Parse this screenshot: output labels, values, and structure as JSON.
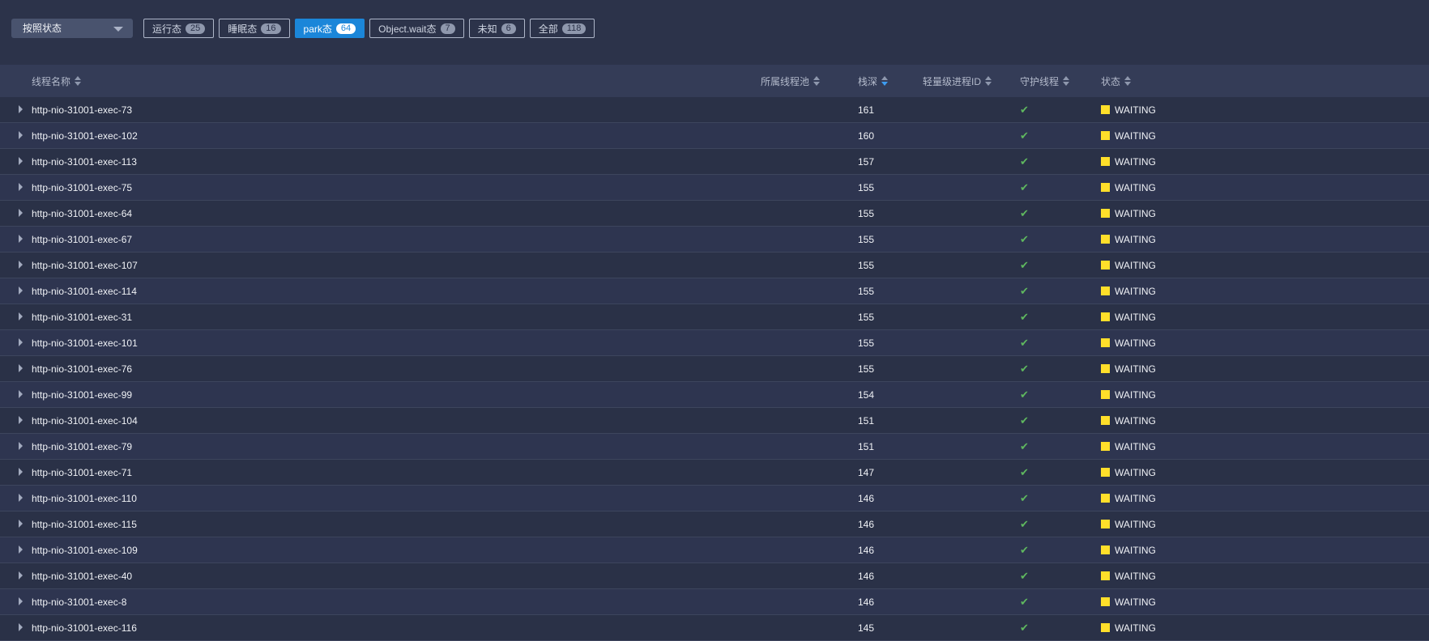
{
  "toolbar": {
    "group_select": {
      "value": "按照状态"
    },
    "filters": [
      {
        "label": "运行态",
        "count": "25",
        "active": false
      },
      {
        "label": "睡眠态",
        "count": "16",
        "active": false
      },
      {
        "label": "park态",
        "count": "64",
        "active": true
      },
      {
        "label": "Object.wait态",
        "count": "7",
        "active": false
      },
      {
        "label": "未知",
        "count": "6",
        "active": false
      },
      {
        "label": "全部",
        "count": "118",
        "active": false
      }
    ]
  },
  "table": {
    "columns": {
      "name": "线程名称",
      "pool": "所属线程池",
      "depth": "栈深",
      "lwp": "轻量级进程ID",
      "daemon": "守护线程",
      "state": "状态"
    },
    "sorted_by": "depth",
    "rows": [
      {
        "name": "http-nio-31001-exec-73",
        "depth": "161",
        "daemon": true,
        "state": "WAITING"
      },
      {
        "name": "http-nio-31001-exec-102",
        "depth": "160",
        "daemon": true,
        "state": "WAITING"
      },
      {
        "name": "http-nio-31001-exec-113",
        "depth": "157",
        "daemon": true,
        "state": "WAITING"
      },
      {
        "name": "http-nio-31001-exec-75",
        "depth": "155",
        "daemon": true,
        "state": "WAITING"
      },
      {
        "name": "http-nio-31001-exec-64",
        "depth": "155",
        "daemon": true,
        "state": "WAITING"
      },
      {
        "name": "http-nio-31001-exec-67",
        "depth": "155",
        "daemon": true,
        "state": "WAITING"
      },
      {
        "name": "http-nio-31001-exec-107",
        "depth": "155",
        "daemon": true,
        "state": "WAITING"
      },
      {
        "name": "http-nio-31001-exec-114",
        "depth": "155",
        "daemon": true,
        "state": "WAITING"
      },
      {
        "name": "http-nio-31001-exec-31",
        "depth": "155",
        "daemon": true,
        "state": "WAITING"
      },
      {
        "name": "http-nio-31001-exec-101",
        "depth": "155",
        "daemon": true,
        "state": "WAITING"
      },
      {
        "name": "http-nio-31001-exec-76",
        "depth": "155",
        "daemon": true,
        "state": "WAITING"
      },
      {
        "name": "http-nio-31001-exec-99",
        "depth": "154",
        "daemon": true,
        "state": "WAITING"
      },
      {
        "name": "http-nio-31001-exec-104",
        "depth": "151",
        "daemon": true,
        "state": "WAITING"
      },
      {
        "name": "http-nio-31001-exec-79",
        "depth": "151",
        "daemon": true,
        "state": "WAITING"
      },
      {
        "name": "http-nio-31001-exec-71",
        "depth": "147",
        "daemon": true,
        "state": "WAITING"
      },
      {
        "name": "http-nio-31001-exec-110",
        "depth": "146",
        "daemon": true,
        "state": "WAITING"
      },
      {
        "name": "http-nio-31001-exec-115",
        "depth": "146",
        "daemon": true,
        "state": "WAITING"
      },
      {
        "name": "http-nio-31001-exec-109",
        "depth": "146",
        "daemon": true,
        "state": "WAITING"
      },
      {
        "name": "http-nio-31001-exec-40",
        "depth": "146",
        "daemon": true,
        "state": "WAITING"
      },
      {
        "name": "http-nio-31001-exec-8",
        "depth": "146",
        "daemon": true,
        "state": "WAITING"
      },
      {
        "name": "http-nio-31001-exec-116",
        "depth": "145",
        "daemon": true,
        "state": "WAITING"
      }
    ]
  },
  "colors": {
    "active_filter": "#1b86d9",
    "waiting_state": "#ffdf2a",
    "daemon_check": "#5fb85f"
  }
}
